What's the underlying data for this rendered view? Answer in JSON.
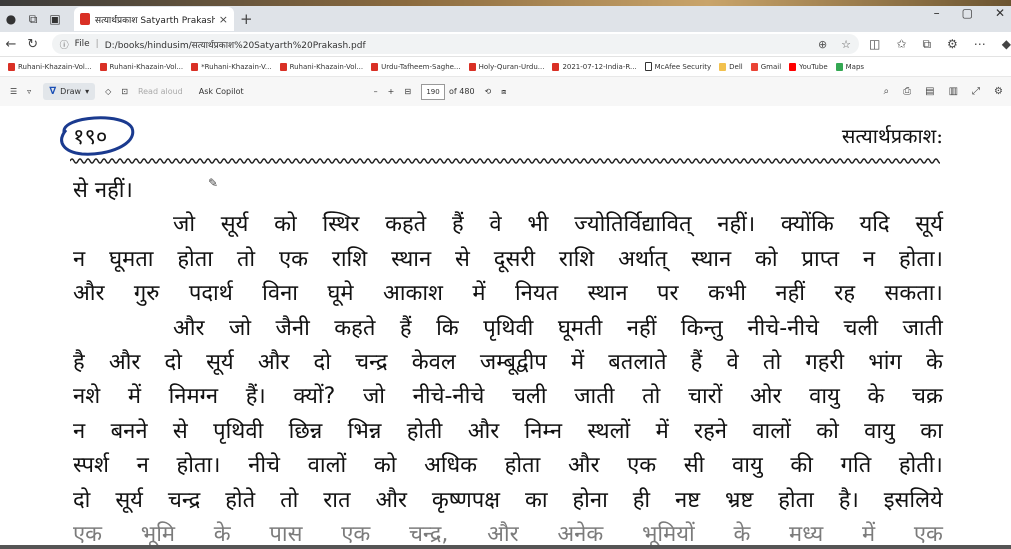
{
  "tab": {
    "title": "सत्यार्थप्रकाश Satyarth Prakash.pd",
    "close": "×",
    "new": "+"
  },
  "window": {
    "minimize": "–",
    "maximize": "▢",
    "close": "✕"
  },
  "address": {
    "info": "ⓘ",
    "scheme": "File",
    "url": "D:/books/hindusim/सत्यार्थप्रकाश%20Satyarth%20Prakash.pdf"
  },
  "bookmarks": [
    {
      "label": "Ruhani-Khazain-Vol...",
      "icon": "pdf-icon"
    },
    {
      "label": "Ruhani-Khazain-Vol...",
      "icon": "pdf-icon"
    },
    {
      "label": "*Ruhani-Khazain-V...",
      "icon": "pdf-icon"
    },
    {
      "label": "Ruhani-Khazain-Vol...",
      "icon": "pdf-icon"
    },
    {
      "label": "Urdu-Tafheem-Saghe...",
      "icon": "pdf-icon"
    },
    {
      "label": "Holy-Quran-Urdu...",
      "icon": "pdf-icon"
    },
    {
      "label": "2021-07-12-India-R...",
      "icon": "pdf-icon"
    },
    {
      "label": "McAfee Security",
      "icon": "doc-icon"
    },
    {
      "label": "Dell",
      "icon": "folder-icon"
    },
    {
      "label": "Gmail",
      "icon": "gmail-icon"
    },
    {
      "label": "YouTube",
      "icon": "youtube-icon"
    },
    {
      "label": "Maps",
      "icon": "maps-icon"
    }
  ],
  "pdf_toolbar": {
    "draw": "Draw",
    "read_aloud": "Read aloud",
    "copilot": "Ask Copilot",
    "zoom_out": "–",
    "zoom_in": "+",
    "page_current": "190",
    "page_total": "of 480"
  },
  "page": {
    "number": "१९०",
    "running_head": "सत्यार्थप्रकाश:",
    "lines": [
      "से नहीं।",
      "जो सूर्य को स्थिर कहते हैं वे भी ज्योतिर्विद्यावित् नहीं। क्योंकि यदि सूर्य",
      "न घूमता होता तो एक राशि स्थान से दूसरी राशि अर्थात् स्थान को प्राप्त न होता।",
      "और गुरु पदार्थ विना घूमे आकाश में नियत स्थान पर कभी नहीं रह सकता।",
      "और जो जैनी कहते हैं कि पृथिवी घूमती नहीं किन्तु नीचे-नीचे चली जाती",
      "है और दो सूर्य और दो चन्द्र केवल जम्बूद्वीप में बतलाते हैं वे तो गहरी भांग के",
      "नशे में निमग्न हैं। क्यों? जो नीचे-नीचे चली जाती तो चारों ओर वायु के चक्र",
      "न बनने से पृथिवी छिन्न भिन्न होती और निम्न स्थलों में रहने वालों को वायु का",
      "स्पर्श न होता। नीचे वालों को अधिक होता और एक सी वायु की गति होती।",
      "दो सूर्य चन्द्र होते तो रात और कृष्णपक्ष का होना ही नष्ट भ्रष्ट होता है। इसलिये",
      "एक भूमि के पास एक चन्द्र, और अनेक भूमियों के मध्य में एक"
    ]
  }
}
